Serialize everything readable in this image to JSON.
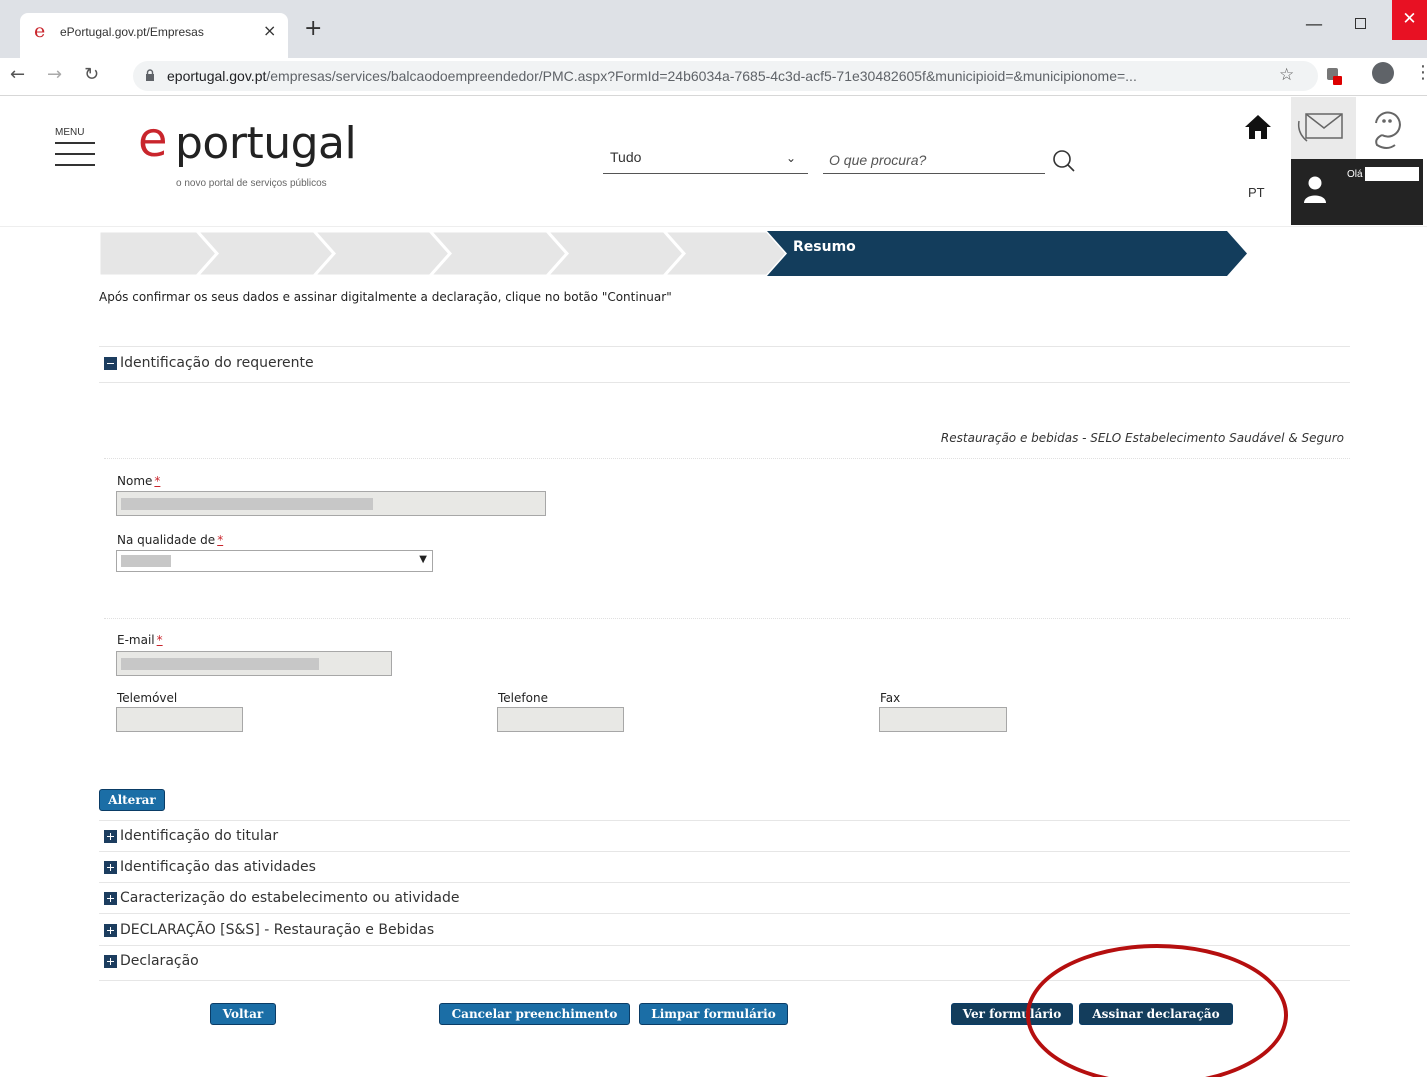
{
  "browser": {
    "tab_title": "ePortugal.gov.pt/Empresas",
    "tab_close": "×",
    "new_tab": "+",
    "url_host": "eportugal.gov.pt",
    "url_path": "/empresas/services/balcaodoempreendedor/PMC.aspx?FormId=24b6034a-7685-4c3d-acf5-71e30482605f&municipioid=&municipionome=..."
  },
  "header": {
    "menu_label": "MENU",
    "logo_mark": "e",
    "logo_text": "portugal",
    "logo_subtitle": "o novo portal de serviços públicos",
    "search_category": "Tudo",
    "search_placeholder": "O que procura?",
    "language": "PT",
    "user_greeting": "Olá"
  },
  "progress": {
    "current_step": "Resumo"
  },
  "instruction": "Após confirmar os seus dados e assinar digitalmente a declaração, clique no botão \"Continuar\"",
  "requerente": {
    "title": "Identificação do requerente",
    "form_type": "Restauração e bebidas - SELO Estabelecimento Saudável & Seguro",
    "fields": {
      "nome": "Nome",
      "qualidade": "Na qualidade de",
      "email": "E-mail",
      "telemovel": "Telemóvel",
      "telefone": "Telefone",
      "fax": "Fax"
    },
    "required_marker": "*",
    "alterar_button": "Alterar"
  },
  "sections": [
    "Identificação do titular",
    "Identificação das atividades",
    "Caracterização do estabelecimento ou atividade",
    "DECLARAÇÃO [S&S] - Restauração e Bebidas",
    "Declaração"
  ],
  "actions": {
    "voltar": "Voltar",
    "cancelar": "Cancelar preenchimento",
    "limpar": "Limpar formulário",
    "ver_formulario": "Ver formulário",
    "assinar": "Assinar declaração"
  },
  "colors": {
    "brand_red": "#c9252c",
    "step_navy": "#133d5c",
    "button_blue": "#1b6ea6",
    "annotation_red": "#b50f0f"
  }
}
